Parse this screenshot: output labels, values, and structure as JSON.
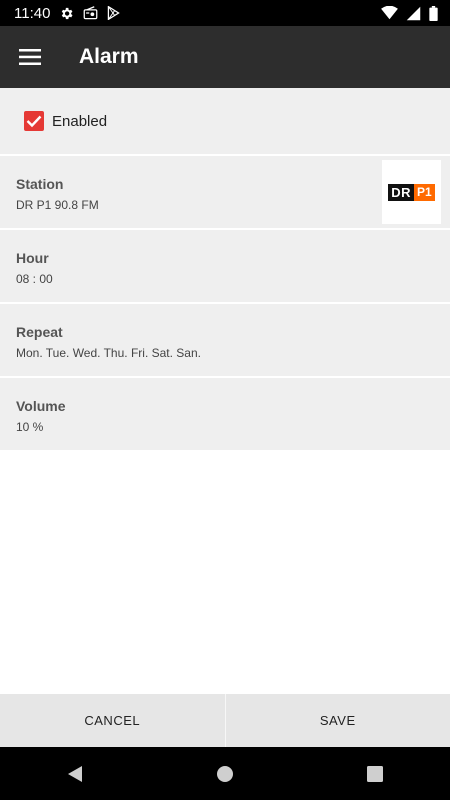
{
  "status_bar": {
    "time": "11:40",
    "icons": [
      "gear-icon",
      "radio-icon",
      "play-store-icon",
      "wifi-icon",
      "signal-icon",
      "battery-icon"
    ]
  },
  "app_bar": {
    "title": "Alarm",
    "menu_icon": "hamburger-menu-icon"
  },
  "enabled": {
    "label": "Enabled",
    "checked": true,
    "color": "#e53935"
  },
  "settings": [
    {
      "title": "Station",
      "value": "DR P1 90.8 FM"
    },
    {
      "title": "Hour",
      "value": "08 : 00"
    },
    {
      "title": "Repeat",
      "value": "Mon. Tue. Wed. Thu. Fri. Sat. San."
    },
    {
      "title": "Volume",
      "value": "10 %"
    }
  ],
  "station_logo": {
    "left": "DR",
    "right": "P1",
    "accent": "#ff6a00"
  },
  "buttons": {
    "cancel": "CANCEL",
    "save": "SAVE"
  },
  "nav_bar": {
    "icons": [
      "back-icon",
      "home-icon",
      "recents-icon"
    ]
  }
}
